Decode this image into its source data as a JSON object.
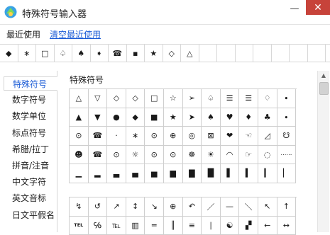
{
  "window": {
    "title": "特殊符号输入器",
    "minimize_glyph": "—",
    "close_glyph": "✕"
  },
  "recent": {
    "label": "最近使用",
    "clear_link": "清空最近使用",
    "symbols": [
      "◆",
      "∗",
      "□",
      "♤",
      "♠",
      "➧",
      "☎",
      "▪",
      "★",
      "◇",
      "△",
      "",
      "",
      "",
      "",
      "",
      "",
      ""
    ]
  },
  "sidebar": {
    "items": [
      "特殊符号",
      "数字符号",
      "数学单位",
      "标点符号",
      "希腊/拉丁",
      "拼音/注音",
      "中文字符",
      "英文音标",
      "日文平假名"
    ],
    "active_index": 0
  },
  "main": {
    "section_title": "特殊符号",
    "grid1": [
      "△",
      "▽",
      "◇",
      "◇",
      "□",
      "☆",
      "➢",
      "♤",
      "☰",
      "☰",
      "♢",
      "∙",
      "▲",
      "▼",
      "●",
      "◆",
      "■",
      "★",
      "➤",
      "♠",
      "♥",
      "♦",
      "♣",
      "∙",
      "⊙",
      "☎",
      "·",
      "∗",
      "⊙",
      "⊕",
      "◎",
      "⊠",
      "❤",
      "☜",
      "◿",
      "☋",
      "☻",
      "☎",
      "⊙",
      "☼",
      "⊙",
      "⊙",
      "☸",
      "☀",
      "◠",
      "☞",
      "◌",
      "⋯⋯",
      "▁",
      "▂",
      "▃",
      "▄",
      "▅",
      "▆",
      "▇",
      "█",
      "▌",
      "▍",
      "▎",
      "▏"
    ],
    "grid2": [
      "↯",
      "↺",
      "↗",
      "↕",
      "↘",
      "⊕",
      "↶",
      "／",
      "—",
      "＼",
      "↖",
      "↑",
      "TEL",
      "℅",
      "℡",
      "▥",
      "═",
      "║",
      "≡",
      "∣",
      "☯",
      "▞",
      "←",
      "↔"
    ],
    "grid2_last_col": [
      "↗",
      "→"
    ]
  }
}
